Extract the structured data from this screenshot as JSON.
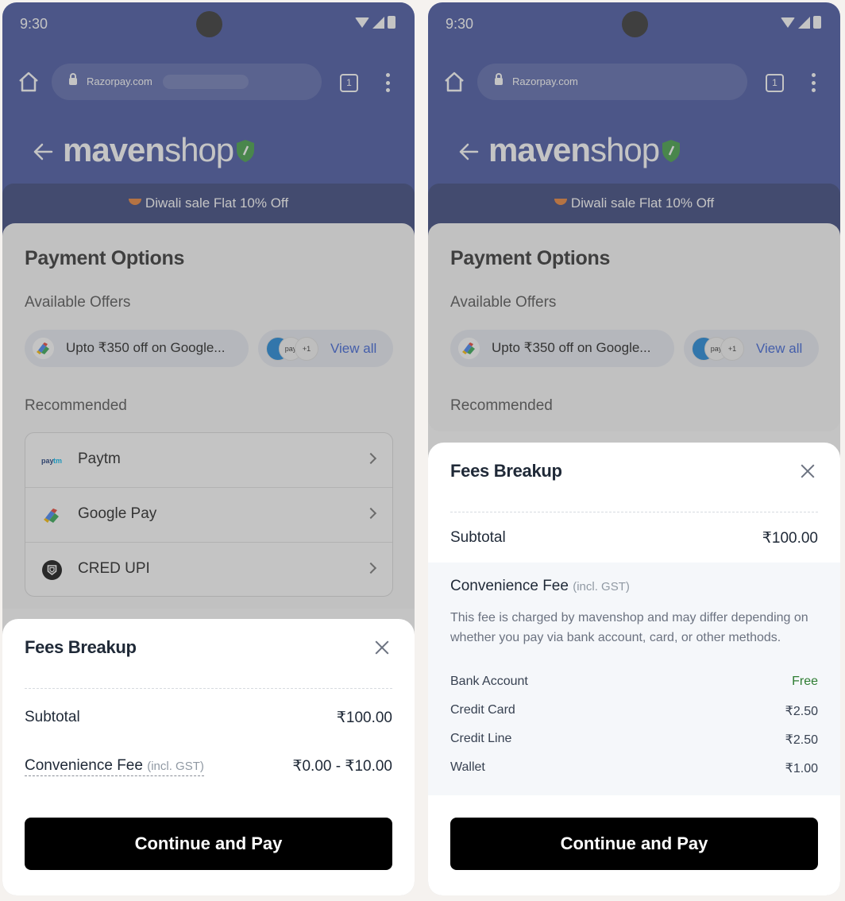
{
  "colors": {
    "header": "#4757a3",
    "offer_strip": "#39457d",
    "link": "#3b63d8",
    "free": "#2e7d32",
    "button": "#000000"
  },
  "status": {
    "time": "9:30"
  },
  "browser": {
    "url": "Razorpay.com",
    "tab_count": "1"
  },
  "merchant": {
    "brand_bold": "maven",
    "brand_light": "shop",
    "sale_banner": "Diwali sale Flat 10% Off"
  },
  "options": {
    "title": "Payment Options",
    "available_offers": "Available Offers",
    "offer_text": "Upto ₹350 off on Google...",
    "more_count": "+1",
    "view_all": "View all",
    "recommended": "Recommended",
    "methods": [
      {
        "label": "Paytm",
        "icon": "paytm-icon"
      },
      {
        "label": "Google Pay",
        "icon": "google-pay-icon"
      },
      {
        "label": "CRED UPI",
        "icon": "cred-icon"
      }
    ]
  },
  "sheet": {
    "title": "Fees Breakup",
    "subtotal_label": "Subtotal",
    "subtotal_value": "₹100.00",
    "conv_label": "Convenience Fee",
    "conv_note": "(incl. GST)",
    "conv_range": "₹0.00 - ₹10.00",
    "conv_desc": "This fee is charged by mavenshop and may differ depending on whether you pay via bank account, card, or other methods.",
    "fees": [
      {
        "label": "Bank Account",
        "value": "Free"
      },
      {
        "label": "Credit Card",
        "value": "₹2.50"
      },
      {
        "label": "Credit Line",
        "value": "₹2.50"
      },
      {
        "label": "Wallet",
        "value": "₹1.00"
      }
    ],
    "pay_button": "Continue and Pay"
  }
}
